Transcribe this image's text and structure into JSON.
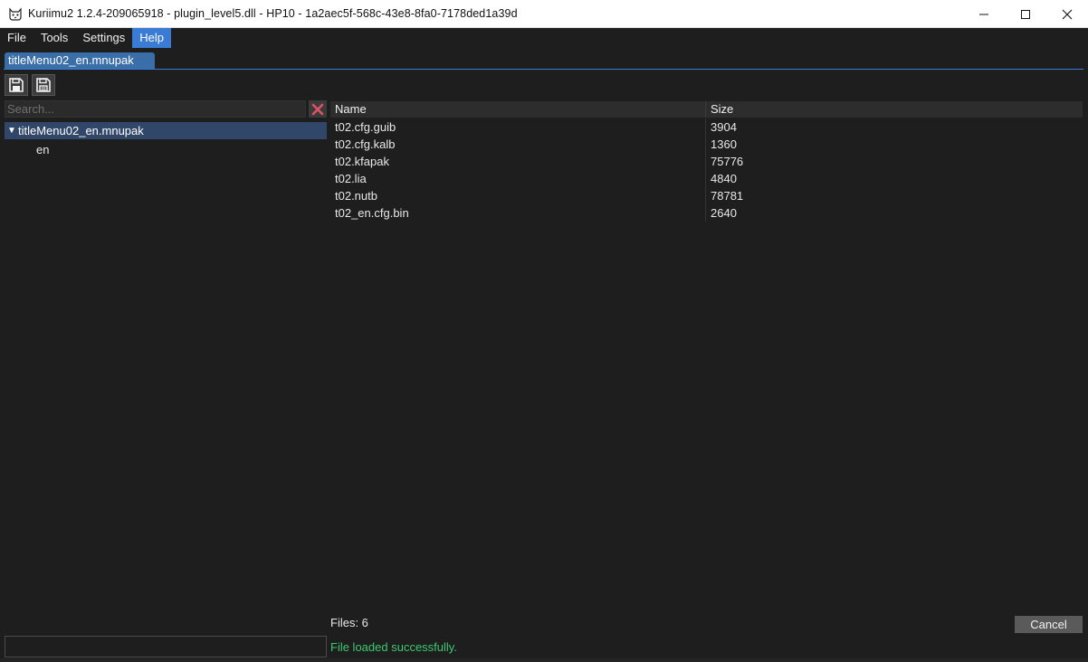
{
  "window": {
    "title": "Kuriimu2 1.2.4-209065918 - plugin_level5.dll - HP10 - 1a2aec5f-568c-43e8-8fa0-7178ded1a39d",
    "app_icon": "cat-face-icon"
  },
  "menubar": {
    "items": [
      {
        "label": "File"
      },
      {
        "label": "Tools"
      },
      {
        "label": "Settings"
      },
      {
        "label": "Help",
        "active": true
      }
    ]
  },
  "tabs": [
    {
      "label": "titleMenu02_en.mnupak",
      "active": true
    }
  ],
  "toolbar": {
    "save_icon": "save-icon",
    "save_as_icon": "save-as-icon"
  },
  "search": {
    "placeholder": "Search...",
    "value": "",
    "clear_icon": "close-x-icon"
  },
  "tree": {
    "root": {
      "label": "titleMenu02_en.mnupak",
      "expanded": true
    },
    "children": [
      {
        "label": "en"
      }
    ]
  },
  "files_table": {
    "columns": [
      "Name",
      "Size"
    ],
    "rows": [
      {
        "name": "t02.cfg.guib",
        "size": "3904"
      },
      {
        "name": "t02.cfg.kalb",
        "size": "1360"
      },
      {
        "name": "t02.kfapak",
        "size": "75776"
      },
      {
        "name": "t02.lia",
        "size": "4840"
      },
      {
        "name": "t02.nutb",
        "size": "78781"
      },
      {
        "name": "t02_en.cfg.bin",
        "size": "2640"
      }
    ]
  },
  "footer": {
    "files_count": "Files: 6",
    "cancel_label": "Cancel",
    "status_message": "File loaded successfully.",
    "status_color": "#3cc870"
  },
  "colors": {
    "accent": "#3a7bd5",
    "background": "#1e1e1e"
  }
}
